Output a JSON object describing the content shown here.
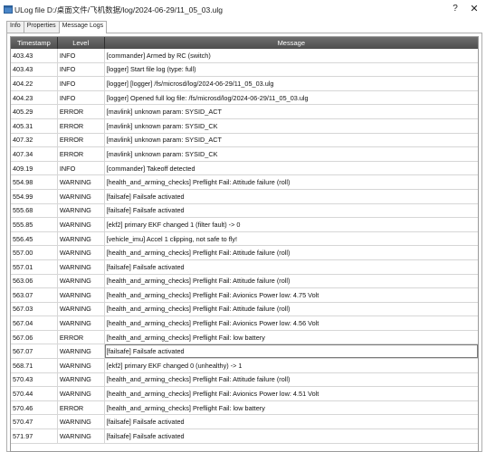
{
  "window": {
    "title": "ULog file D:/桌面文件/飞机数据/log/2024-06-29/11_05_03.ulg",
    "help_label": "?",
    "close_label": "✕",
    "icon": "app-icon"
  },
  "tabs": [
    {
      "label": "Info",
      "active": false
    },
    {
      "label": "Properties",
      "active": false
    },
    {
      "label": "Message Logs",
      "active": true
    }
  ],
  "table": {
    "columns": [
      "Timestamp",
      "Level",
      "Message"
    ],
    "rows": [
      [
        "403.43",
        "INFO",
        "[commander] Armed by RC (switch)"
      ],
      [
        "403.43",
        "INFO",
        "[logger] Start file log (type: full)"
      ],
      [
        "404.22",
        "INFO",
        "[logger] [logger] /fs/microsd/log/2024-06-29/11_05_03.ulg"
      ],
      [
        "404.23",
        "INFO",
        "[logger] Opened full log file: /fs/microsd/log/2024-06-29/11_05_03.ulg"
      ],
      [
        "405.29",
        "ERROR",
        "[mavlink] unknown param: SYSID_ACT"
      ],
      [
        "405.31",
        "ERROR",
        "[mavlink] unknown param: SYSID_CK"
      ],
      [
        "407.32",
        "ERROR",
        "[mavlink] unknown param: SYSID_ACT"
      ],
      [
        "407.34",
        "ERROR",
        "[mavlink] unknown param: SYSID_CK"
      ],
      [
        "409.19",
        "INFO",
        "[commander] Takeoff detected"
      ],
      [
        "554.98",
        "WARNING",
        "[health_and_arming_checks] Preflight Fail: Attitude failure (roll)"
      ],
      [
        "554.99",
        "WARNING",
        "[failsafe] Failsafe activated"
      ],
      [
        "555.68",
        "WARNING",
        "[failsafe] Failsafe activated"
      ],
      [
        "555.85",
        "WARNING",
        "[ekf2] primary EKF changed 1 (filter fault) -> 0"
      ],
      [
        "556.45",
        "WARNING",
        "[vehicle_imu] Accel 1 clipping, not safe to fly!"
      ],
      [
        "557.00",
        "WARNING",
        "[health_and_arming_checks] Preflight Fail: Attitude failure (roll)"
      ],
      [
        "557.01",
        "WARNING",
        "[failsafe] Failsafe activated"
      ],
      [
        "563.06",
        "WARNING",
        "[health_and_arming_checks] Preflight Fail: Attitude failure (roll)"
      ],
      [
        "563.07",
        "WARNING",
        "[health_and_arming_checks] Preflight Fail: Avionics Power low:   4.75 Volt"
      ],
      [
        "567.03",
        "WARNING",
        "[health_and_arming_checks] Preflight Fail: Attitude failure (roll)"
      ],
      [
        "567.04",
        "WARNING",
        "[health_and_arming_checks] Preflight Fail: Avionics Power low:   4.56 Volt"
      ],
      [
        "567.06",
        "ERROR",
        "[health_and_arming_checks] Preflight Fail: low battery"
      ],
      [
        "567.07",
        "WARNING",
        "[failsafe] Failsafe activated"
      ],
      [
        "568.71",
        "WARNING",
        "[ekf2] primary EKF changed 0 (unhealthy) -> 1"
      ],
      [
        "570.43",
        "WARNING",
        "[health_and_arming_checks] Preflight Fail: Attitude failure (roll)"
      ],
      [
        "570.44",
        "WARNING",
        "[health_and_arming_checks] Preflight Fail: Avionics Power low:   4.51 Volt"
      ],
      [
        "570.46",
        "ERROR",
        "[health_and_arming_checks] Preflight Fail: low battery"
      ],
      [
        "570.47",
        "WARNING",
        "[failsafe] Failsafe activated"
      ],
      [
        "571.97",
        "WARNING",
        "[failsafe] Failsafe activated"
      ]
    ],
    "selected_row_index": 21
  }
}
